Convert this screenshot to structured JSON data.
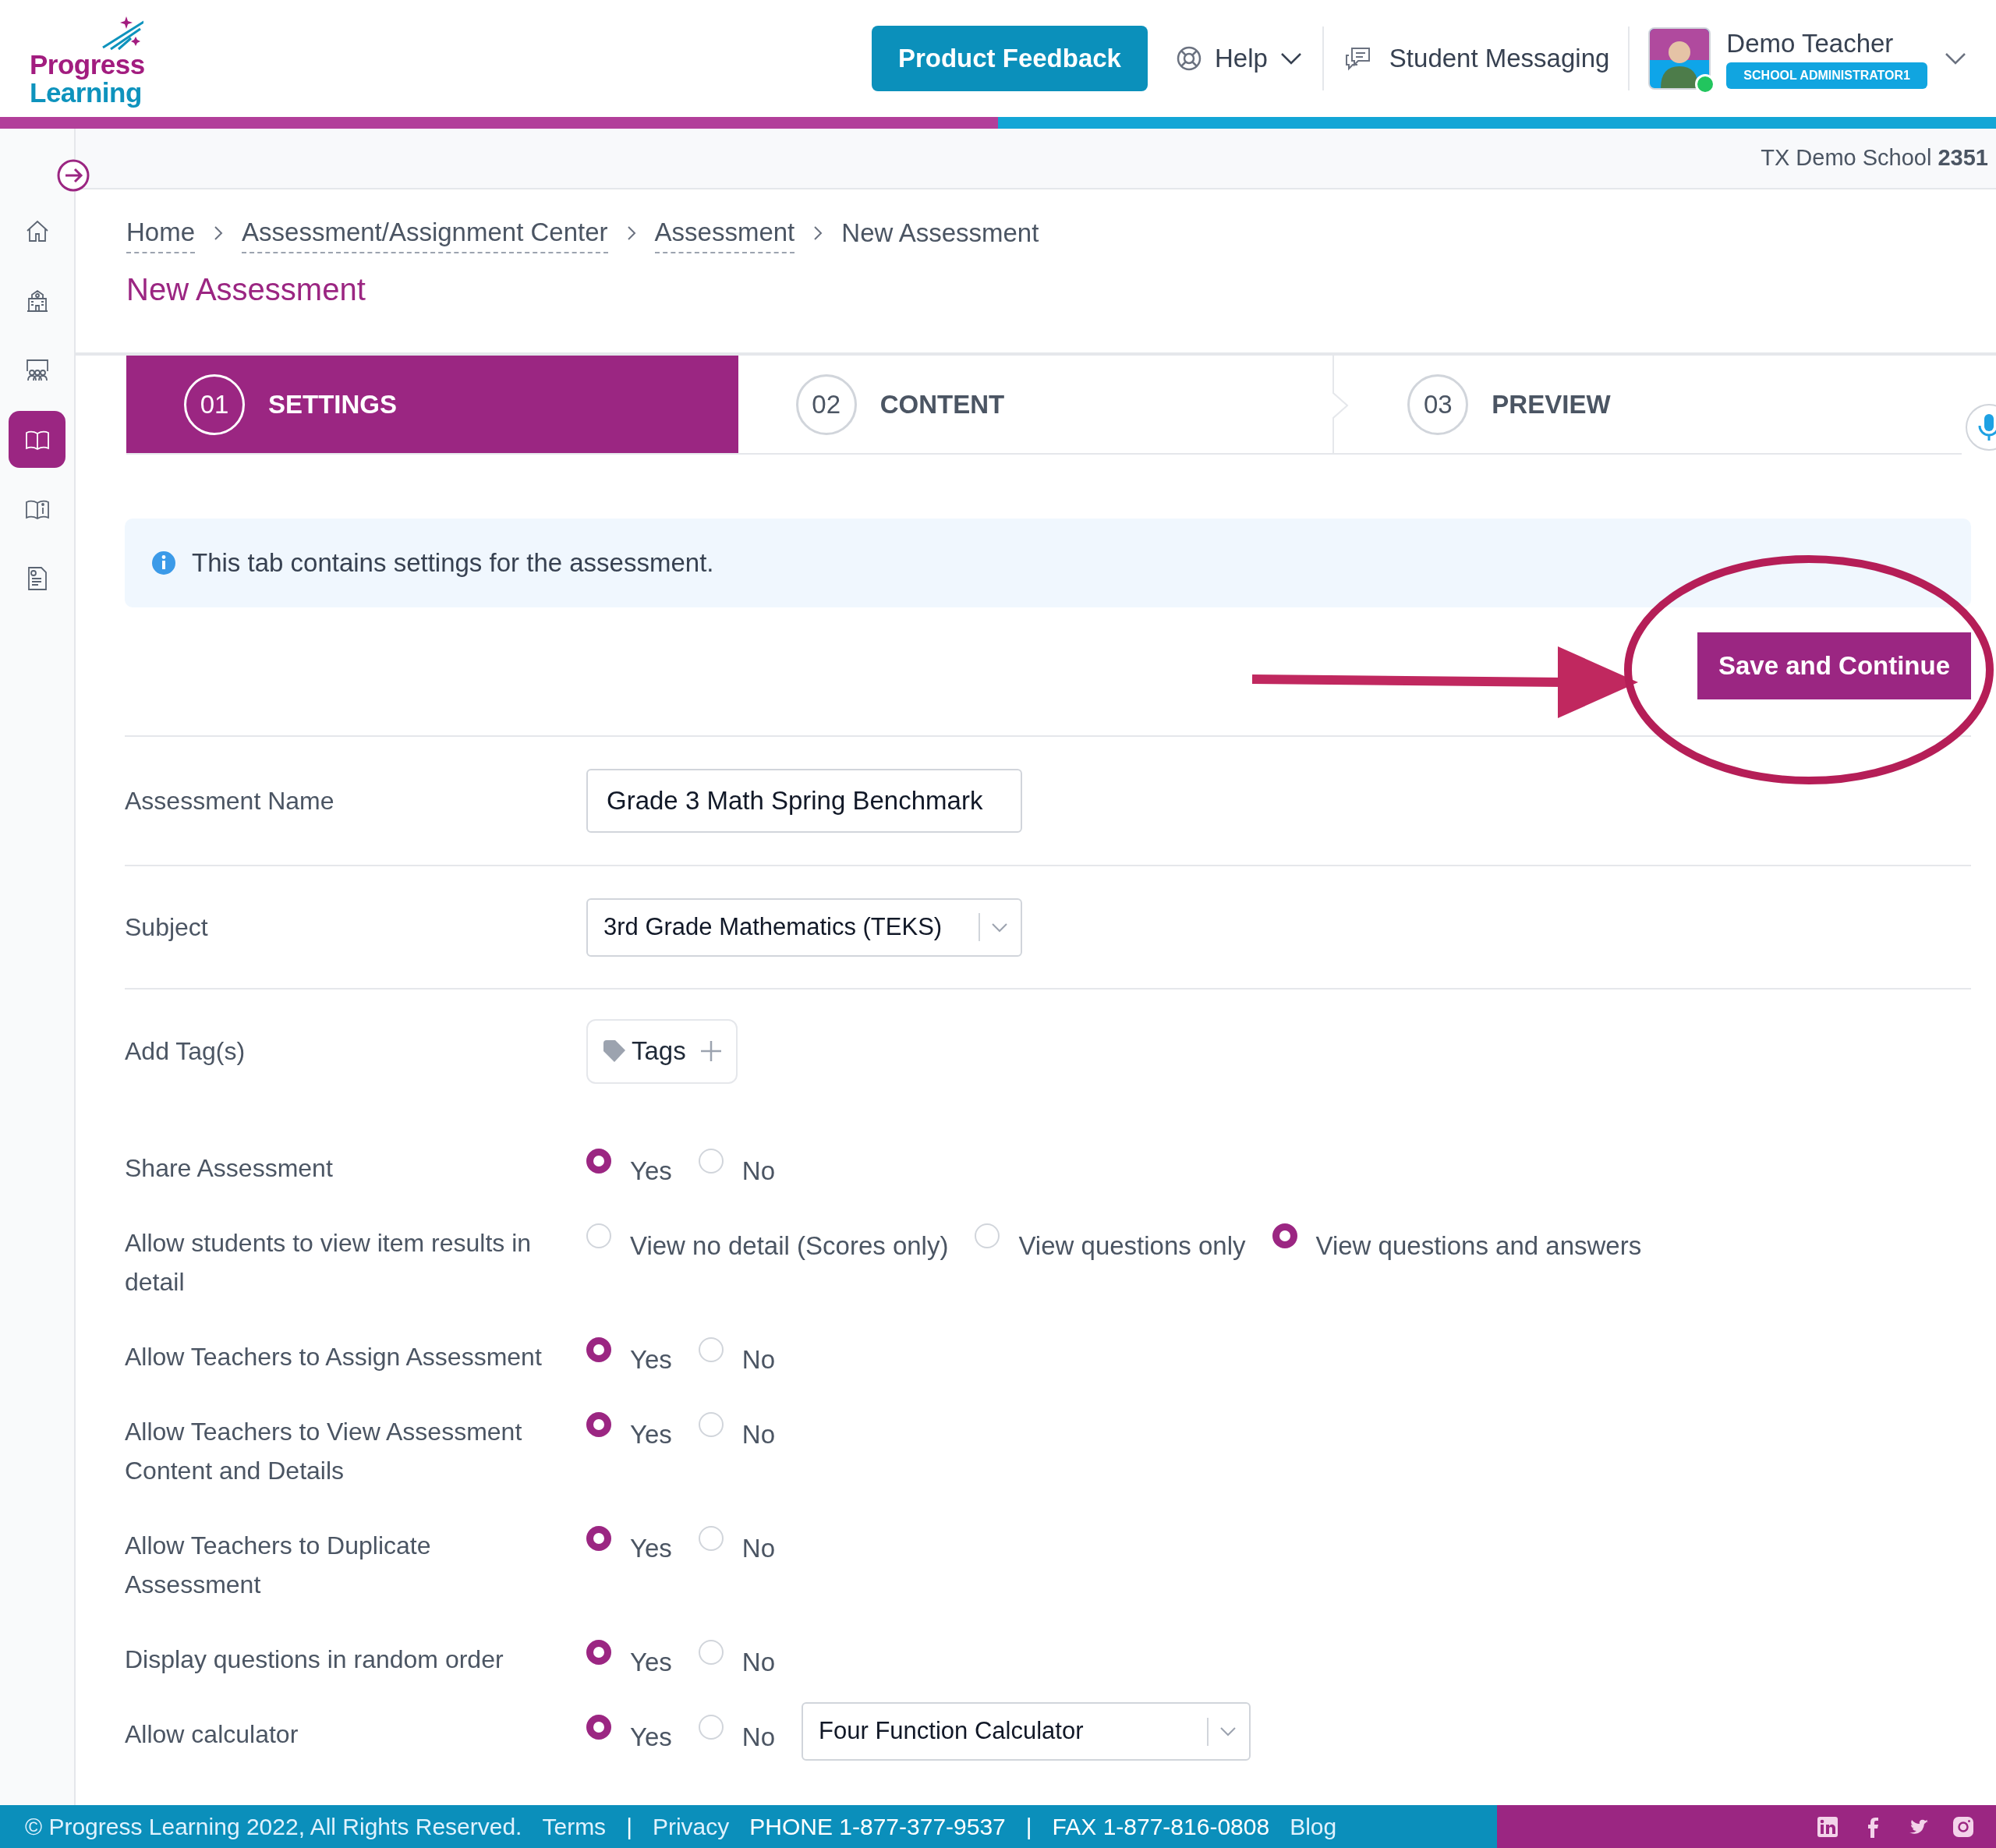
{
  "header": {
    "logo": {
      "line1": "Progress",
      "line2": "Learning"
    },
    "feedback_button": "Product Feedback",
    "help": "Help",
    "messaging": "Student Messaging",
    "user": {
      "name": "Demo Teacher",
      "role": "SCHOOL ADMINISTRATOR1",
      "online": true
    }
  },
  "school": {
    "name": "TX Demo School",
    "number": "2351"
  },
  "sidebar": {
    "items": [
      {
        "selected": false
      },
      {
        "selected": false
      },
      {
        "selected": false
      },
      {
        "selected": true
      },
      {
        "selected": false
      },
      {
        "selected": false
      }
    ]
  },
  "breadcrumb": [
    {
      "label": "Home",
      "link": true
    },
    {
      "label": "Assessment/Assignment Center",
      "link": true
    },
    {
      "label": "Assessment",
      "link": true
    },
    {
      "label": "New Assessment",
      "link": false
    }
  ],
  "page_title": "New Assessment",
  "steps": [
    {
      "number": "01",
      "label": "SETTINGS",
      "selected": true
    },
    {
      "number": "02",
      "label": "CONTENT",
      "selected": false
    },
    {
      "number": "03",
      "label": "PREVIEW",
      "selected": false
    }
  ],
  "info": "This tab contains settings for the assessment.",
  "save_button": "Save and Continue",
  "form": [
    {
      "kind": "text",
      "label": "Assessment Name",
      "value": "Grade 3 Math Spring Benchmark"
    },
    {
      "kind": "select",
      "label": "Subject",
      "value": "3rd Grade Mathematics (TEKS)"
    },
    {
      "kind": "tags",
      "label": "Add Tag(s)",
      "button": "Tags"
    },
    {
      "kind": "radio",
      "label": "Share Assessment",
      "options": [
        {
          "label": "Yes",
          "selected": true
        },
        {
          "label": "No",
          "selected": false
        }
      ]
    },
    {
      "kind": "radio",
      "label": "Allow students to view item results in detail",
      "options": [
        {
          "label": "View no detail (Scores only)",
          "selected": false
        },
        {
          "label": "View questions only",
          "selected": false
        },
        {
          "label": "View questions and answers",
          "selected": true
        }
      ]
    },
    {
      "kind": "radio",
      "label": "Allow Teachers to Assign Assessment",
      "options": [
        {
          "label": "Yes",
          "selected": true
        },
        {
          "label": "No",
          "selected": false
        }
      ]
    },
    {
      "kind": "radio",
      "label": "Allow Teachers to View Assessment Content and Details",
      "options": [
        {
          "label": "Yes",
          "selected": true
        },
        {
          "label": "No",
          "selected": false
        }
      ]
    },
    {
      "kind": "radio",
      "label": "Allow Teachers to Duplicate Assessment",
      "options": [
        {
          "label": "Yes",
          "selected": true
        },
        {
          "label": "No",
          "selected": false
        }
      ]
    },
    {
      "kind": "radio",
      "label": "Display questions in random order",
      "options": [
        {
          "label": "Yes",
          "selected": true
        },
        {
          "label": "No",
          "selected": false
        }
      ]
    },
    {
      "kind": "radio",
      "label": "Allow calculator",
      "options": [
        {
          "label": "Yes",
          "selected": true
        },
        {
          "label": "No",
          "selected": false
        }
      ],
      "dropdown": "Four Function Calculator"
    }
  ],
  "footer": {
    "copyright": "© Progress Learning 2022, All Rights Reserved.",
    "links": [
      {
        "kind": "link",
        "text": "Terms"
      },
      {
        "kind": "sep",
        "text": "|"
      },
      {
        "kind": "link",
        "text": "Privacy"
      },
      {
        "kind": "info",
        "text": "PHONE 1-877-377-9537"
      },
      {
        "kind": "sep",
        "text": "|"
      },
      {
        "kind": "info",
        "text": "FAX 1-877-816-0808"
      },
      {
        "kind": "link",
        "text": "Blog"
      }
    ]
  }
}
